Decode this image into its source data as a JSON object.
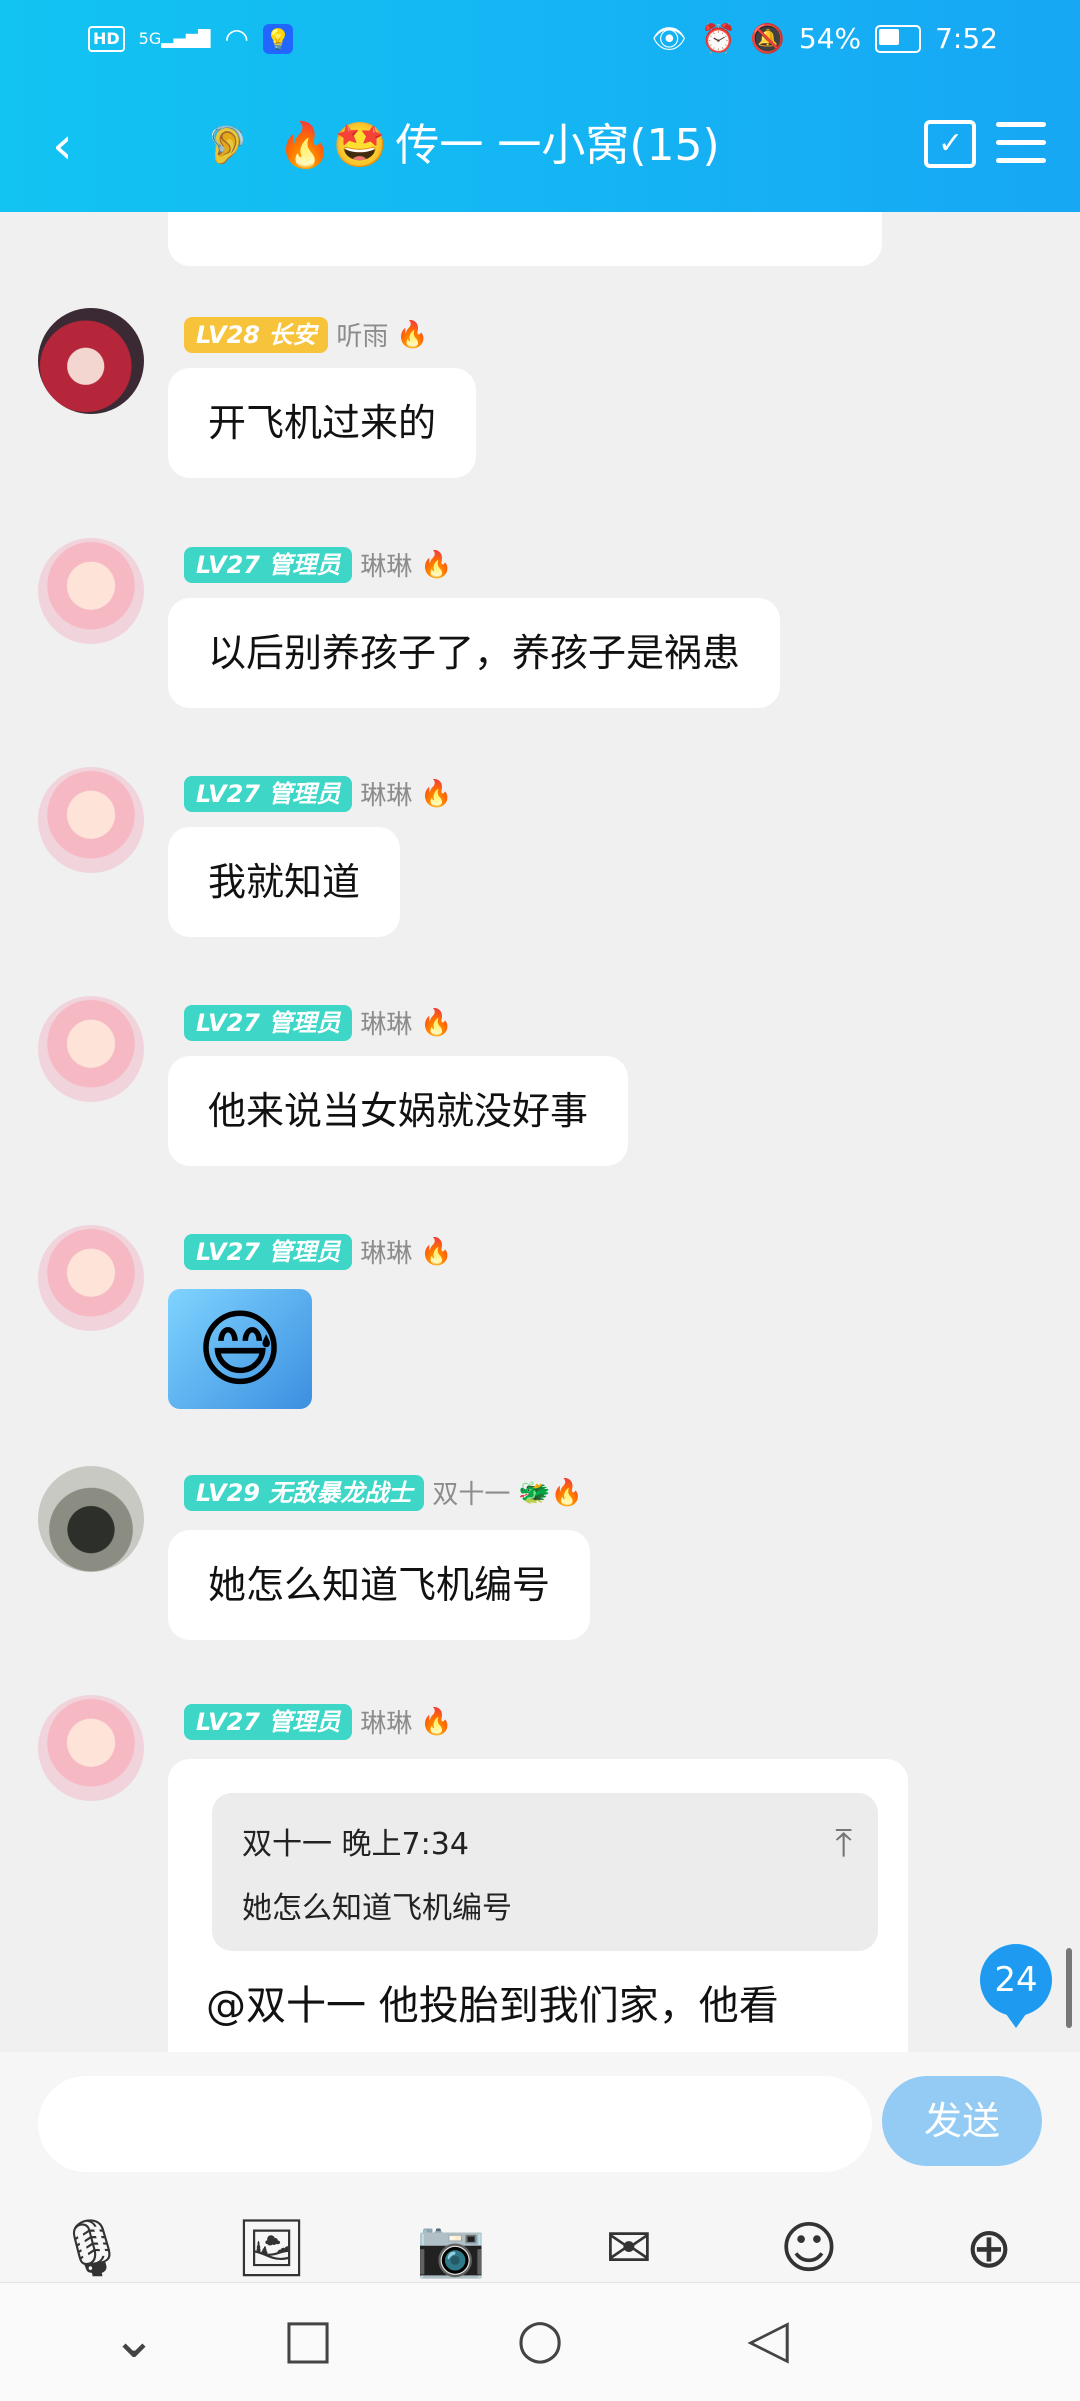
{
  "status_bar": {
    "hd": "HD",
    "signal": "5G",
    "battery": "54%",
    "time": "7:52"
  },
  "header": {
    "title": "传一 一小窝(15)",
    "title_emojis": "🔥🤩",
    "ear_icon": "ear-icon",
    "back_icon": "chevron-left-icon"
  },
  "messages": [
    {
      "badge": "LV28 长安",
      "name": "听雨",
      "flame": "🔥",
      "text": "开飞机过来的"
    },
    {
      "badge": "LV27 管理员",
      "name": "琳琳",
      "flame": "🔥",
      "text": "以后别养孩子了，养孩子是祸患"
    },
    {
      "badge": "LV27 管理员",
      "name": "琳琳",
      "flame": "🔥",
      "text": "我就知道"
    },
    {
      "badge": "LV27 管理员",
      "name": "琳琳",
      "flame": "🔥",
      "text": "他来说当女娲就没好事"
    },
    {
      "badge": "LV27 管理员",
      "name": "琳琳",
      "flame": "🔥",
      "sticker": "😅"
    },
    {
      "badge": "LV29 无敌暴龙战士",
      "name": "双十一",
      "flame": "🐲🔥",
      "text": "她怎么知道飞机编号"
    },
    {
      "badge": "LV27 管理员",
      "name": "琳琳",
      "flame": "🔥",
      "quote": {
        "header": "双十一 晚上7:34",
        "text": "她怎么知道飞机编号"
      },
      "reply": "@双十一 他投胎到我们家，他看"
    }
  ],
  "unread_count": "24",
  "input": {
    "placeholder": "",
    "send_label": "发送"
  },
  "colors": {
    "header": "#17a7f4",
    "badge_teal": "#3ed6c7",
    "badge_gold": "#f7c33a",
    "send": "#93cbf4"
  }
}
